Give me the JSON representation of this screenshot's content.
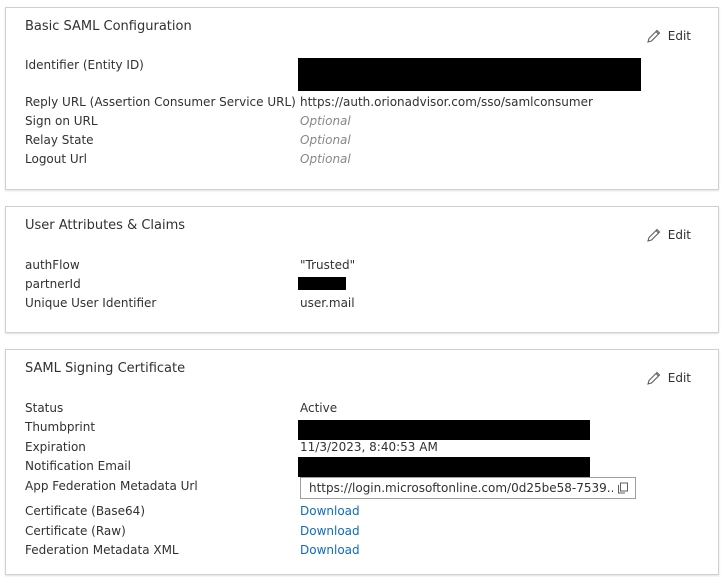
{
  "saml_config": {
    "title": "Basic SAML Configuration",
    "edit_label": "Edit",
    "rows": [
      {
        "label": "Identifier (Entity ID)",
        "value": ""
      },
      {
        "label": "Reply URL (Assertion Consumer Service URL)",
        "value": "https://auth.orionadvisor.com/sso/samlconsumer"
      },
      {
        "label": "Sign on URL",
        "value": "Optional"
      },
      {
        "label": "Relay State",
        "value": "Optional"
      },
      {
        "label": "Logout Url",
        "value": "Optional"
      }
    ]
  },
  "claims": {
    "title": "User Attributes & Claims",
    "edit_label": "Edit",
    "rows": [
      {
        "label": "authFlow",
        "value": "\"Trusted\""
      },
      {
        "label": "partnerId",
        "value": ""
      },
      {
        "label": "Unique User Identifier",
        "value": "user.mail"
      }
    ]
  },
  "certificate": {
    "title": "SAML Signing Certificate",
    "edit_label": "Edit",
    "rows": [
      {
        "label": "Status",
        "value": "Active"
      },
      {
        "label": "Thumbprint",
        "value": ""
      },
      {
        "label": "Expiration",
        "value": "11/3/2023, 8:40:53 AM"
      },
      {
        "label": "Notification Email",
        "value": ""
      },
      {
        "label": "App Federation Metadata Url",
        "value": "https://login.microsoftonline.com/0d25be58-7539..."
      },
      {
        "label": "Certificate (Base64)",
        "value": "Download"
      },
      {
        "label": "Certificate (Raw)",
        "value": "Download"
      },
      {
        "label": "Federation Metadata XML",
        "value": "Download"
      }
    ]
  },
  "colors": {
    "link": "#0f6cbd",
    "text": "#323130",
    "optional": "#8a8886",
    "border": "#d2d0ce"
  },
  "icons": {
    "edit": "pencil-icon",
    "copy": "copy-icon"
  }
}
